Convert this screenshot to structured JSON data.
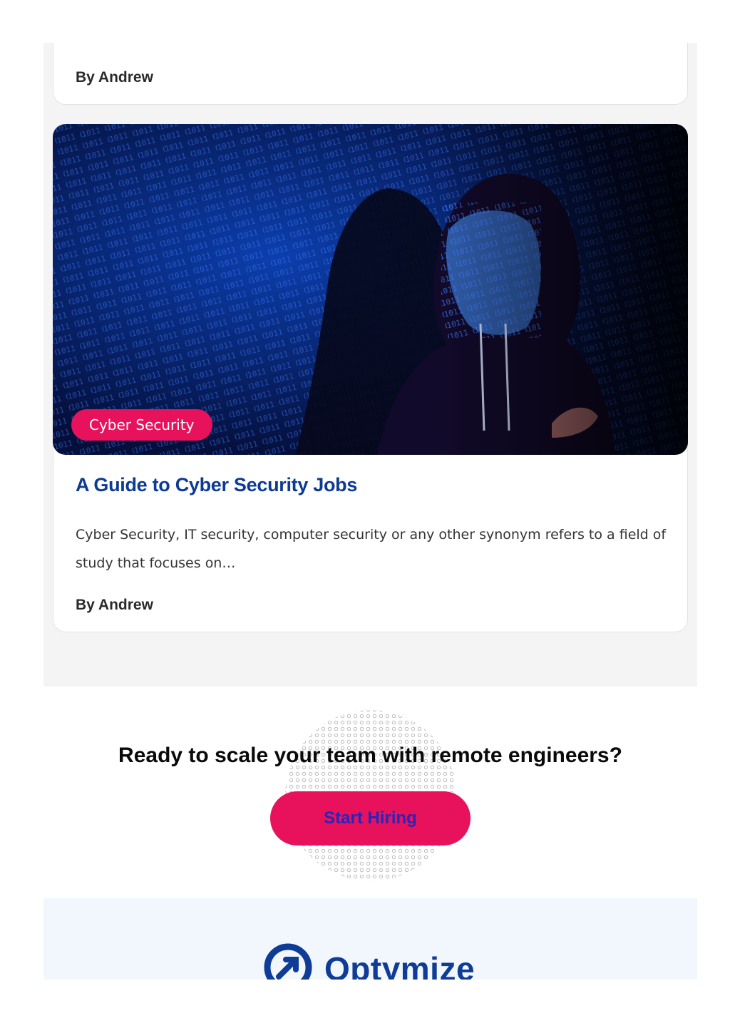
{
  "previous_card": {
    "author": "By Andrew"
  },
  "post": {
    "image_alt": "Hooded figure with binary code projected on face",
    "category": "Cyber Security",
    "title": "A Guide to Cyber Security Jobs",
    "excerpt": "Cyber Security, IT security, computer security or any other synonym refers to a field of study that focuses on…",
    "author": "By Andrew"
  },
  "cta": {
    "heading": "Ready to scale your team with remote engineers?",
    "button_label": "Start Hiring"
  },
  "footer": {
    "brand": "Optymize"
  },
  "colors": {
    "accent_pink": "#e8125c",
    "title_blue": "#0d3a93",
    "section_gray": "#f4f4f5",
    "footer_bg": "#f1f7fd"
  }
}
